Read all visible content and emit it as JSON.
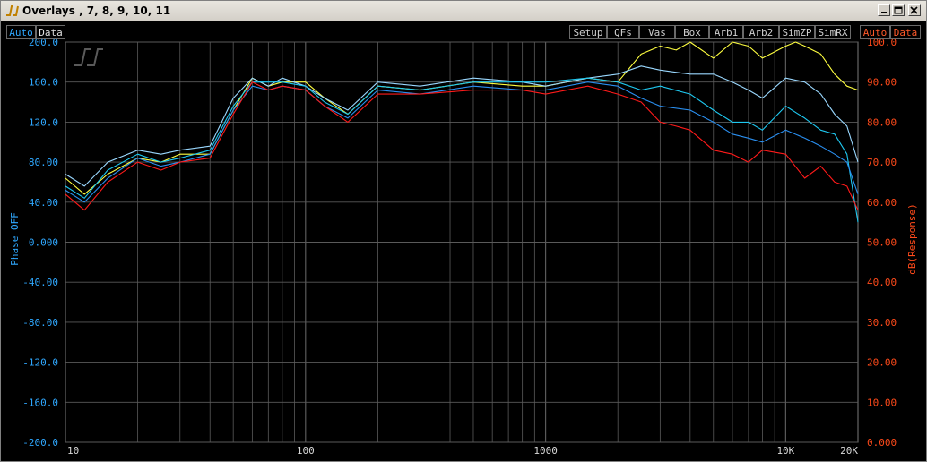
{
  "window": {
    "title": "Overlays , 7, 8, 9, 10, 11",
    "minimize_glyph": "minimize-icon",
    "maximize_glyph": "maximize-icon",
    "close_glyph": "close-icon"
  },
  "toolbar": {
    "left_auto": "Auto",
    "left_data": "Data",
    "right_auto": "Auto",
    "right_data": "Data",
    "buttons": [
      "Setup",
      "QFs",
      "Vas",
      "Box",
      "Arb1",
      "Arb2",
      "SimZP",
      "SimRX"
    ]
  },
  "colors": {
    "background": "#000000",
    "grid": "#5a5a5a",
    "left_axis": "#2fa8ff",
    "right_axis": "#ff4a1a",
    "x_axis_text": "#d8d8d8"
  },
  "chart_data": {
    "type": "line",
    "x_scale": "log",
    "xlim": [
      10,
      20000
    ],
    "x_tick_labels": [
      "10",
      "100",
      "1000",
      "10K",
      "20K"
    ],
    "x_tick_values": [
      10,
      100,
      1000,
      10000,
      20000
    ],
    "ylabel_left": "Phase OFF",
    "ylim_left": [
      -200,
      200
    ],
    "y_tick_labels_left": [
      "200.0",
      "160.0",
      "120.0",
      "80.00",
      "40.00",
      "0.000",
      "-40.00",
      "-80.00",
      "-120.0",
      "-160.0",
      "-200.0"
    ],
    "ylabel_right": "dB(Response)",
    "ylim_right": [
      0,
      100
    ],
    "y_tick_labels_right": [
      "100.0",
      "90.00",
      "80.00",
      "70.00",
      "60.00",
      "50.00",
      "40.00",
      "30.00",
      "20.00",
      "10.00",
      "0.000"
    ],
    "grid": true,
    "series": [
      {
        "color": "#ffff40",
        "axis": "right",
        "x": [
          10,
          12,
          15,
          20,
          25,
          30,
          40,
          50,
          60,
          70,
          80,
          100,
          120,
          150,
          200,
          300,
          500,
          800,
          1000,
          1500,
          2000,
          2500,
          3000,
          3500,
          4000,
          5000,
          6000,
          7000,
          8000,
          10000,
          11000,
          12000,
          14000,
          16000,
          18000,
          20000
        ],
        "y": [
          66,
          62,
          67,
          71,
          70,
          72,
          72,
          83,
          91,
          89,
          90,
          90,
          86,
          82,
          89,
          88,
          90,
          89,
          89,
          91,
          90,
          97,
          99,
          98,
          100,
          96,
          100,
          99,
          96,
          99,
          100,
          99,
          97,
          92,
          89,
          88
        ]
      },
      {
        "color": "#9ad8ff",
        "axis": "right",
        "x": [
          10,
          12,
          15,
          20,
          25,
          30,
          40,
          50,
          60,
          70,
          80,
          100,
          120,
          150,
          200,
          300,
          500,
          800,
          1000,
          1500,
          2000,
          2500,
          3000,
          4000,
          5000,
          6000,
          7000,
          8000,
          10000,
          12000,
          14000,
          16000,
          18000,
          20000
        ],
        "y": [
          67,
          64,
          70,
          73,
          72,
          73,
          74,
          86,
          91,
          89,
          91,
          89,
          86,
          83,
          90,
          89,
          91,
          90,
          89,
          91,
          92,
          94,
          93,
          92,
          92,
          90,
          88,
          86,
          91,
          90,
          87,
          82,
          79,
          70
        ]
      },
      {
        "color": "#1ec8f0",
        "axis": "right",
        "x": [
          10,
          12,
          15,
          20,
          25,
          30,
          40,
          50,
          60,
          70,
          80,
          100,
          120,
          150,
          200,
          300,
          500,
          800,
          1000,
          1500,
          2000,
          2500,
          3000,
          4000,
          5000,
          6000,
          7000,
          8000,
          10000,
          12000,
          14000,
          16000,
          18000,
          20000
        ],
        "y": [
          64,
          61,
          68,
          72,
          70,
          71,
          73,
          84,
          90,
          90,
          90,
          89,
          85,
          82,
          89,
          88,
          90,
          90,
          90,
          91,
          90,
          88,
          89,
          87,
          83,
          80,
          80,
          78,
          84,
          81,
          78,
          77,
          72,
          55
        ]
      },
      {
        "color": "#2a8ff0",
        "axis": "right",
        "x": [
          10,
          12,
          15,
          20,
          25,
          30,
          40,
          50,
          60,
          70,
          80,
          100,
          120,
          150,
          200,
          300,
          500,
          800,
          1000,
          1500,
          2000,
          2500,
          3000,
          4000,
          5000,
          6000,
          7000,
          8000,
          10000,
          12000,
          14000,
          16000,
          18000,
          20000
        ],
        "y": [
          63,
          60,
          66,
          71,
          69,
          70,
          72,
          83,
          89,
          88,
          89,
          88,
          84,
          81,
          88,
          87,
          89,
          88,
          88,
          90,
          89,
          86,
          84,
          83,
          80,
          77,
          76,
          75,
          78,
          76,
          74,
          72,
          70,
          62
        ]
      },
      {
        "color": "#ff1a1a",
        "axis": "right",
        "x": [
          10,
          12,
          15,
          20,
          25,
          30,
          40,
          50,
          60,
          70,
          80,
          100,
          120,
          150,
          200,
          300,
          500,
          800,
          1000,
          1500,
          2000,
          2500,
          3000,
          3500,
          4000,
          5000,
          6000,
          7000,
          8000,
          10000,
          12000,
          14000,
          16000,
          18000,
          20000
        ],
        "y": [
          62,
          58,
          65,
          70,
          68,
          70,
          71,
          82,
          90,
          88,
          89,
          88,
          84,
          80,
          87,
          87,
          88,
          88,
          87,
          89,
          87,
          85,
          80,
          79,
          78,
          73,
          72,
          70,
          73,
          72,
          66,
          69,
          65,
          64,
          58
        ]
      }
    ]
  }
}
